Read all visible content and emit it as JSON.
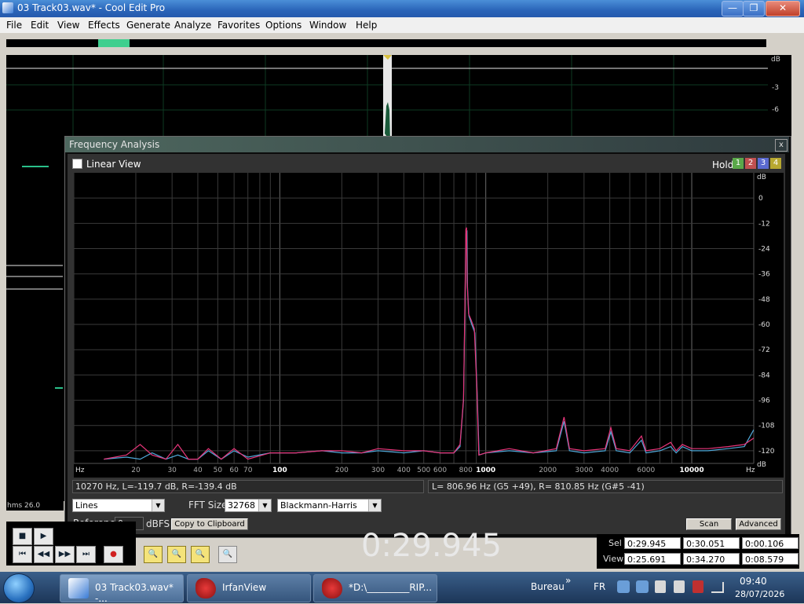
{
  "window": {
    "title": "03 Track03.wav* - Cool Edit Pro",
    "minimize": "—",
    "maximize": "❐",
    "close": "✕"
  },
  "menu": [
    "File",
    "Edit",
    "View",
    "Effects",
    "Generate",
    "Analyze",
    "Favorites",
    "Options",
    "Window",
    "Help"
  ],
  "waveform": {
    "db_labels": [
      "dB",
      "-3",
      "-6"
    ],
    "time_format": "hms",
    "zoom_value": "26.0"
  },
  "frequency_analysis": {
    "title": "Frequency Analysis",
    "close": "x",
    "linear_view_label": "Linear View",
    "linear_view_checked": false,
    "hold_label": "Hold",
    "hold_buttons": [
      {
        "label": "1",
        "color": "#5aa84a"
      },
      {
        "label": "2",
        "color": "#c05050"
      },
      {
        "label": "3",
        "color": "#5a6ad0"
      },
      {
        "label": "4",
        "color": "#b8a830"
      }
    ],
    "status_left": "10270 Hz, L=-119.7 dB, R=-139.4 dB",
    "status_right": "L= 806.96 Hz (G5 +49), R= 810.85 Hz (G#5 -41)",
    "display_mode": "Lines",
    "fft_size_label": "FFT Size",
    "fft_size": "32768",
    "window_function": "Blackmann-Harris",
    "reference_label": "Reference",
    "reference_value": "0",
    "reference_unit": "dBFS",
    "copy_button": "Copy to Clipboard",
    "scan_button": "Scan",
    "advanced_button": "Advanced"
  },
  "chart_data": {
    "type": "line",
    "title": "",
    "xlabel": "Hz",
    "ylabel": "dB",
    "x_scale": "log",
    "xlim": [
      10,
      20000
    ],
    "ylim": [
      -126,
      12
    ],
    "x_tick_labels": [
      {
        "v": 20,
        "t": "20"
      },
      {
        "v": 30,
        "t": "30"
      },
      {
        "v": 40,
        "t": "40"
      },
      {
        "v": 50,
        "t": "50"
      },
      {
        "v": 60,
        "t": "60"
      },
      {
        "v": 70,
        "t": "70"
      },
      {
        "v": 100,
        "t": "100"
      },
      {
        "v": 200,
        "t": "200"
      },
      {
        "v": 300,
        "t": "300"
      },
      {
        "v": 400,
        "t": "400"
      },
      {
        "v": 500,
        "t": "500"
      },
      {
        "v": 600,
        "t": "600"
      },
      {
        "v": 800,
        "t": "800"
      },
      {
        "v": 1000,
        "t": "1000"
      },
      {
        "v": 2000,
        "t": "2000"
      },
      {
        "v": 3000,
        "t": "3000"
      },
      {
        "v": 4000,
        "t": "4000"
      },
      {
        "v": 6000,
        "t": "6000"
      },
      {
        "v": 10000,
        "t": "10000"
      }
    ],
    "y_ticks": [
      0,
      -12,
      -24,
      -36,
      -48,
      -60,
      -72,
      -84,
      -96,
      -108,
      -120
    ],
    "grid": true,
    "series": [
      {
        "color": "#e8357a",
        "points": [
          [
            14,
            -124
          ],
          [
            18,
            -122
          ],
          [
            21,
            -117
          ],
          [
            24,
            -122
          ],
          [
            28,
            -124
          ],
          [
            32,
            -117
          ],
          [
            36,
            -124
          ],
          [
            40,
            -124
          ],
          [
            45,
            -119
          ],
          [
            52,
            -124
          ],
          [
            60,
            -119
          ],
          [
            70,
            -124
          ],
          [
            90,
            -121
          ],
          [
            120,
            -121
          ],
          [
            160,
            -120
          ],
          [
            200,
            -120
          ],
          [
            250,
            -121
          ],
          [
            300,
            -119
          ],
          [
            400,
            -120
          ],
          [
            500,
            -120
          ],
          [
            600,
            -121
          ],
          [
            700,
            -121
          ],
          [
            750,
            -117
          ],
          [
            780,
            -95
          ],
          [
            795,
            -40
          ],
          [
            800,
            -15
          ],
          [
            806.96,
            -14
          ],
          [
            812,
            -40
          ],
          [
            825,
            -55
          ],
          [
            850,
            -58
          ],
          [
            880,
            -62
          ],
          [
            905,
            -90
          ],
          [
            925,
            -122
          ],
          [
            1000,
            -121
          ],
          [
            1300,
            -119
          ],
          [
            1700,
            -121
          ],
          [
            2200,
            -119
          ],
          [
            2400,
            -104
          ],
          [
            2550,
            -119
          ],
          [
            3000,
            -120
          ],
          [
            3800,
            -119
          ],
          [
            4050,
            -109
          ],
          [
            4300,
            -119
          ],
          [
            5000,
            -120
          ],
          [
            5700,
            -113
          ],
          [
            6000,
            -120
          ],
          [
            7000,
            -119
          ],
          [
            7900,
            -116
          ],
          [
            8400,
            -120
          ],
          [
            9000,
            -117
          ],
          [
            10000,
            -119
          ],
          [
            12000,
            -119
          ],
          [
            15000,
            -118
          ],
          [
            18000,
            -117
          ],
          [
            20000,
            -114
          ]
        ]
      },
      {
        "color": "#4fa7d8",
        "points": [
          [
            14,
            -124
          ],
          [
            18,
            -123
          ],
          [
            21,
            -124
          ],
          [
            24,
            -121
          ],
          [
            28,
            -124
          ],
          [
            32,
            -122
          ],
          [
            36,
            -124
          ],
          [
            40,
            -124
          ],
          [
            45,
            -120
          ],
          [
            52,
            -124
          ],
          [
            60,
            -120
          ],
          [
            70,
            -123
          ],
          [
            90,
            -121
          ],
          [
            120,
            -121
          ],
          [
            160,
            -120
          ],
          [
            200,
            -121
          ],
          [
            250,
            -121
          ],
          [
            300,
            -120
          ],
          [
            400,
            -121
          ],
          [
            500,
            -120
          ],
          [
            600,
            -121
          ],
          [
            700,
            -121
          ],
          [
            750,
            -118
          ],
          [
            780,
            -96
          ],
          [
            795,
            -42
          ],
          [
            800,
            -17
          ],
          [
            810.85,
            -16
          ],
          [
            815,
            -42
          ],
          [
            828,
            -56
          ],
          [
            855,
            -60
          ],
          [
            885,
            -64
          ],
          [
            908,
            -92
          ],
          [
            928,
            -122
          ],
          [
            1000,
            -121
          ],
          [
            1300,
            -120
          ],
          [
            1700,
            -121
          ],
          [
            2200,
            -120
          ],
          [
            2400,
            -106
          ],
          [
            2550,
            -120
          ],
          [
            3000,
            -121
          ],
          [
            3800,
            -120
          ],
          [
            4050,
            -111
          ],
          [
            4300,
            -120
          ],
          [
            5000,
            -121
          ],
          [
            5700,
            -115
          ],
          [
            6000,
            -121
          ],
          [
            7000,
            -120
          ],
          [
            7900,
            -118
          ],
          [
            8400,
            -121
          ],
          [
            9000,
            -118
          ],
          [
            10000,
            -120
          ],
          [
            12000,
            -120
          ],
          [
            15000,
            -119
          ],
          [
            18000,
            -118
          ],
          [
            20000,
            -110
          ]
        ]
      }
    ]
  },
  "transport": {
    "time": "0:29.945",
    "buttons": [
      "■",
      "▶",
      "⏮",
      "◀◀",
      "▶▶",
      "⏭",
      "●"
    ]
  },
  "selection_view": {
    "sel_label": "Sel",
    "view_label": "View",
    "sel": [
      "0:29.945",
      "0:30.051",
      "0:00.106"
    ],
    "view": [
      "0:25.691",
      "0:34.270",
      "0:08.579"
    ]
  },
  "taskbar": {
    "tasks": [
      "03 Track03.wav* -...",
      "IrfanView",
      "*D:\\_________RIP..."
    ],
    "toolbar_label": "Bureau",
    "chevron": "»",
    "language": "FR",
    "time": "09:40",
    "date": "28/07/2026"
  }
}
